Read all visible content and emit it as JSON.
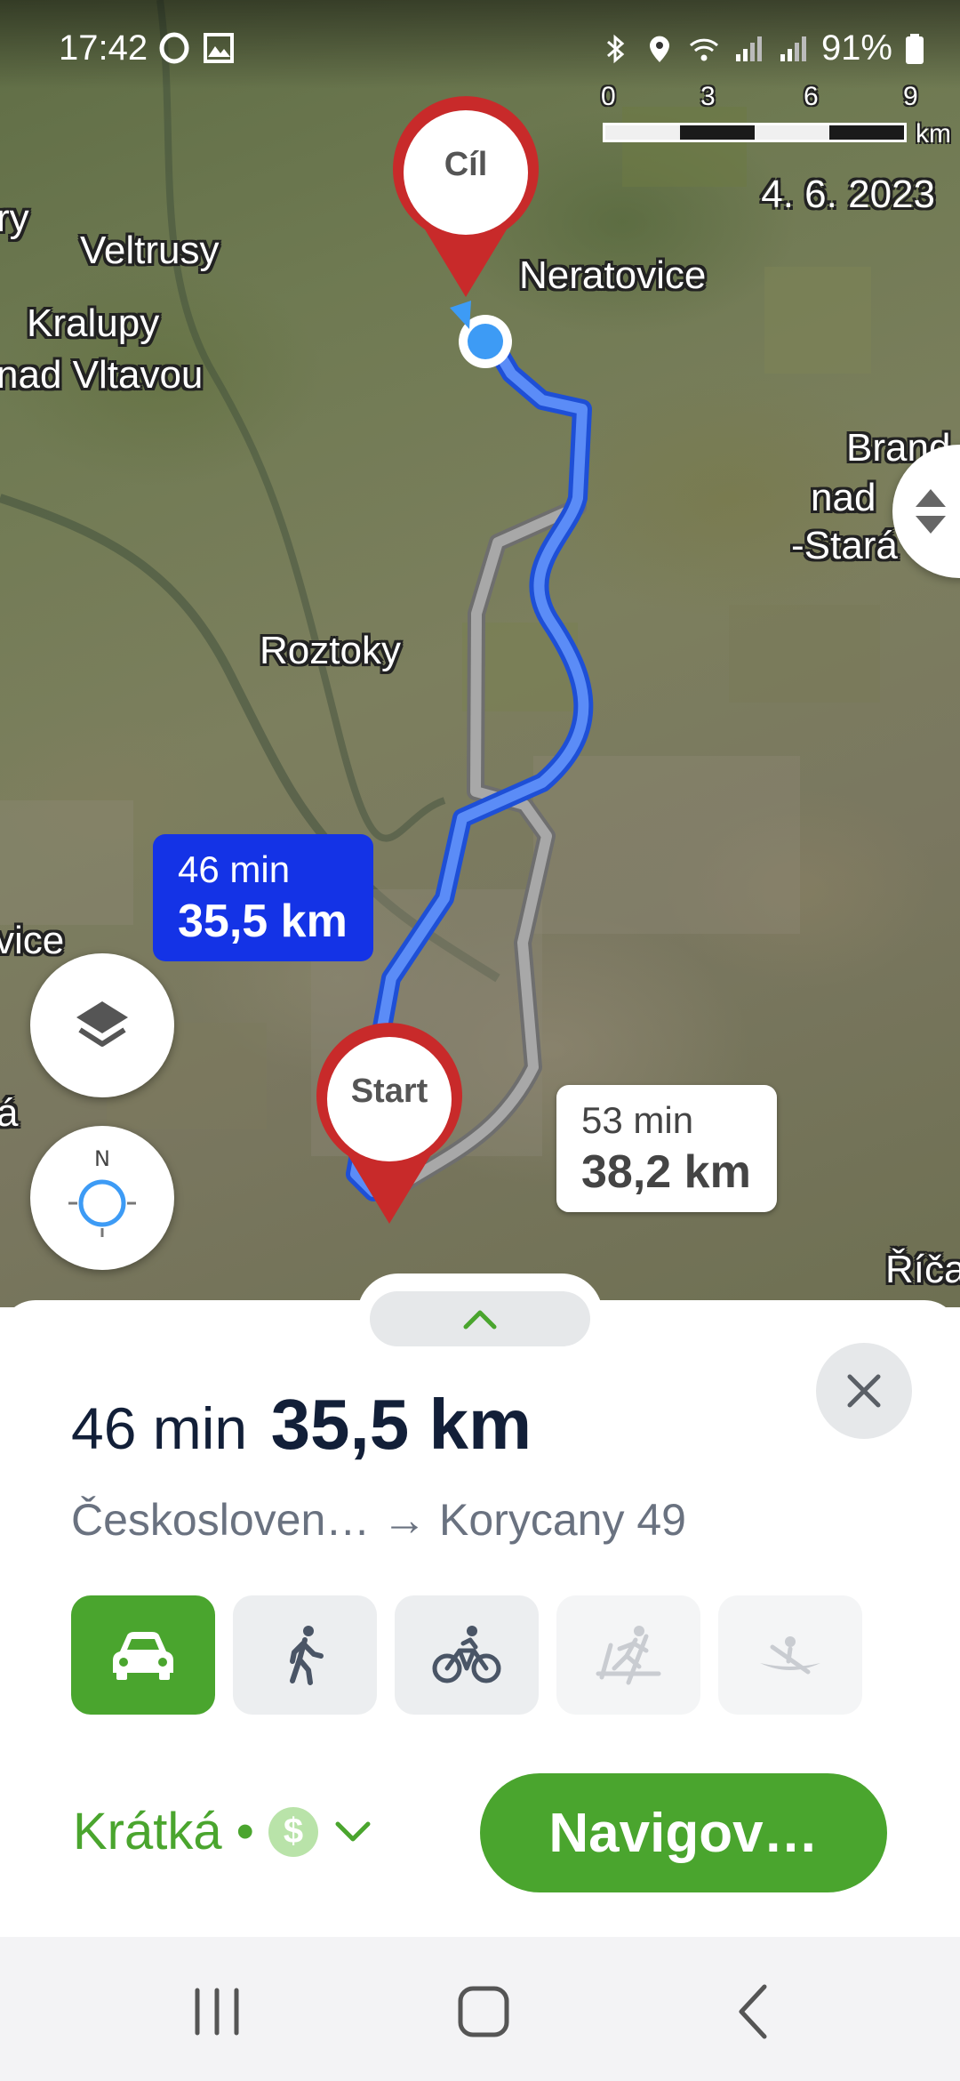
{
  "status_bar": {
    "time": "17:42",
    "battery": "91%",
    "icons": [
      "opera-icon",
      "gallery-icon",
      "bluetooth-icon",
      "location-icon",
      "wifi-icon",
      "signal-icon",
      "signal-icon",
      "battery-icon"
    ]
  },
  "map": {
    "scale": {
      "ticks": [
        "0",
        "3",
        "6",
        "9"
      ],
      "unit": "km"
    },
    "date": "4. 6. 2023",
    "labels": {
      "veltrusy": "Veltrusy",
      "kralupy_1": "Kralupy",
      "kralupy_2": "nad Vltavou",
      "neratovice": "Neratovice",
      "roztoky": "Roztoky",
      "brandys_1": "Brand",
      "brandys_2": "nad",
      "brandys_3": "-Stará",
      "edge_left_1": "ry",
      "edge_left_2": "vice",
      "edge_left_3": "á",
      "ricany": "Říča"
    },
    "destination_pin": "Cíl",
    "start_pin": "Start",
    "route_main": {
      "time": "46 min",
      "distance": "35,5 km"
    },
    "route_alt": {
      "time": "53 min",
      "distance": "38,2 km"
    },
    "colors": {
      "main_route": "#3d73f5",
      "alt_route": "#a8a8a8",
      "pin": "#c82a2a"
    }
  },
  "sheet": {
    "time": "46 min",
    "distance": "35,5 km",
    "route_description": "Českosloven… → Korycany 49",
    "modes": [
      {
        "name": "car",
        "active": true
      },
      {
        "name": "walk",
        "active": false
      },
      {
        "name": "bike",
        "active": false
      },
      {
        "name": "ski",
        "active": false,
        "disabled": true
      },
      {
        "name": "canoe",
        "active": false,
        "disabled": true
      }
    ],
    "route_type": "Krátká",
    "separator": "•",
    "toll_symbol": "$",
    "navigate_label": "Navigov…",
    "accent": "#4aa52e"
  }
}
